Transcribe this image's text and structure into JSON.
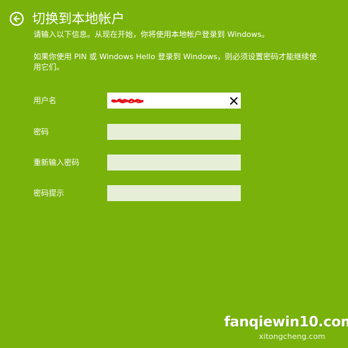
{
  "header": {
    "back_icon": "back-arrow-icon",
    "title": "切换到本地帐户"
  },
  "intro": {
    "line1": "请输入以下信息。从现在开始，你将使用本地帐户登录到 Windows。",
    "line2": "如果你使用 PIN 或 Windows Hello 登录到 Windows，则必须设置密码才能继续使用它们。"
  },
  "form": {
    "username": {
      "label": "用户名",
      "value": "",
      "clear_icon": "close-icon"
    },
    "password": {
      "label": "密码",
      "value": ""
    },
    "confirm_password": {
      "label": "重新输入密码",
      "value": ""
    },
    "password_hint": {
      "label": "密码提示",
      "value": ""
    }
  },
  "watermark": {
    "main": "fanqiewin10.com",
    "sub": "xitongcheng.com"
  },
  "colors": {
    "background": "#78b20a",
    "text": "#ffffff",
    "input_inactive": "#e6eed7",
    "input_active": "#ffffff",
    "redaction": "#e8101a"
  }
}
